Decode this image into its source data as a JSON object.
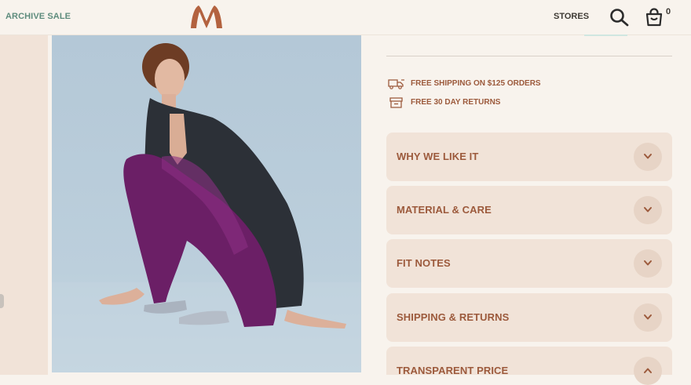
{
  "header": {
    "archive_sale": "ARCHIVE SALE",
    "logo_icon": "brand-m-logo",
    "stores": "STORES",
    "search_icon": "search-icon",
    "bag_icon": "shopping-bag-icon",
    "bag_count": "0"
  },
  "product": {
    "image_icon": "model-photo"
  },
  "perks": [
    {
      "icon": "delivery-truck-icon",
      "text": "FREE SHIPPING ON $125 ORDERS"
    },
    {
      "icon": "return-box-icon",
      "text": "FREE 30 DAY RETURNS"
    }
  ],
  "accordion": [
    {
      "title": "WHY WE LIKE IT",
      "state": "collapsed",
      "icon": "chevron-down-icon"
    },
    {
      "title": "MATERIAL & CARE",
      "state": "collapsed",
      "icon": "chevron-down-icon"
    },
    {
      "title": "FIT NOTES",
      "state": "collapsed",
      "icon": "chevron-down-icon"
    },
    {
      "title": "SHIPPING & RETURNS",
      "state": "collapsed",
      "icon": "chevron-down-icon"
    },
    {
      "title": "TRANSPARENT PRICE",
      "state": "expanded",
      "icon": "chevron-up-icon"
    }
  ],
  "colors": {
    "background": "#f8f3ed",
    "panel": "#f1e3d8",
    "brand": "#b3623f",
    "accent_text": "#9c5a3c",
    "link_green": "#5e8c7d"
  }
}
